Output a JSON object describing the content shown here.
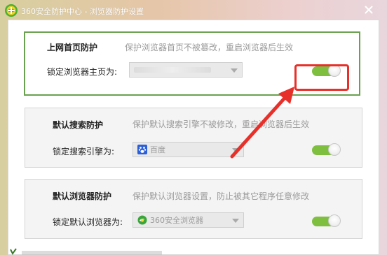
{
  "window": {
    "title": "360安全防护中心 - 浏览器防护设置",
    "close_glyph": "×"
  },
  "sections": [
    {
      "title": "上网首页防护",
      "description": "保护浏览器首页不被篡改，重启浏览器后生效",
      "label": "锁定浏览器主页为:",
      "dropdown_value": "",
      "dropdown_icon": "blurred-url",
      "toggle_on": true
    },
    {
      "title": "默认搜索防护",
      "description": "保护默认搜索引擎不被修改，重启浏览器后生效",
      "label": "锁定搜索引擎为:",
      "dropdown_value": "百度",
      "dropdown_icon": "baidu-paw-icon",
      "toggle_on": true
    },
    {
      "title": "默认浏览器防护",
      "description": "保护默认浏览器设置，防止被其它程序任意修改",
      "label": "锁定默认浏览器为:",
      "dropdown_value": "360安全浏览器",
      "dropdown_icon": "360-browser-icon",
      "toggle_on": true
    }
  ],
  "colors": {
    "active_border": "#6aa150",
    "toggle_green": "#7fbf3f",
    "annotation_red": "#e8302a",
    "baidu_blue": "#2b5fd9",
    "browser_green": "#3aa63a"
  }
}
